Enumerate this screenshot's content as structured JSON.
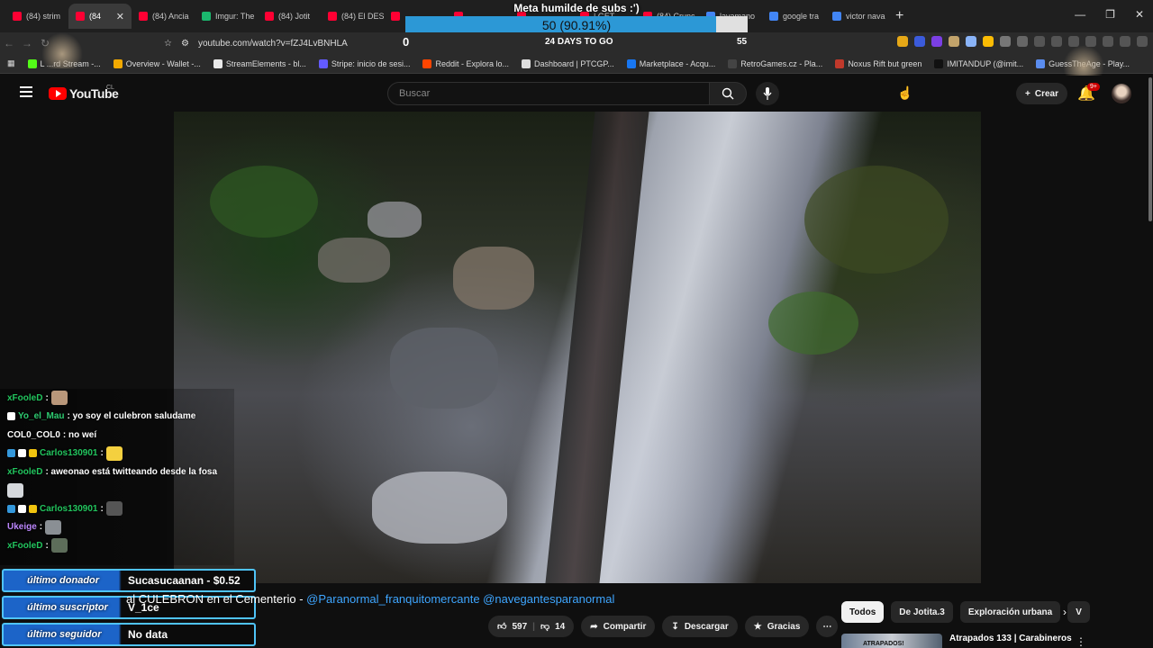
{
  "browser": {
    "tabs": [
      {
        "label": "(84) strim",
        "color": "#ff0033",
        "active": false
      },
      {
        "label": "(84",
        "color": "#ff0033",
        "active": true
      },
      {
        "label": "(84) Ancia",
        "color": "#ff0033",
        "active": false
      },
      {
        "label": "Imgur: The",
        "color": "#1bb76e",
        "active": false
      },
      {
        "label": "(84) Jotit",
        "color": "#ff0033",
        "active": false
      },
      {
        "label": "(84) El DES",
        "color": "#ff0033",
        "active": false
      },
      {
        "label": "",
        "color": "#ff0033",
        "active": false
      },
      {
        "label": "",
        "color": "#ff0033",
        "active": false
      },
      {
        "label": "",
        "color": "#ff0033",
        "active": false
      },
      {
        "label": "| GET",
        "color": "#ff0033",
        "active": false
      },
      {
        "label": "(84) Crunc",
        "color": "#ff0033",
        "active": false
      },
      {
        "label": "lavamano",
        "color": "#4285f4",
        "active": false
      },
      {
        "label": "google tra",
        "color": "#4285f4",
        "active": false
      },
      {
        "label": "victor nava",
        "color": "#4285f4",
        "active": false
      }
    ],
    "url": "youtube.com/watch?v=fZJ4LvBNHLA",
    "bookmarks": [
      {
        "label": "L   ...rd Stream -...",
        "color": "#53fc18"
      },
      {
        "label": "Overview - Wallet -...",
        "color": "#f2a900"
      },
      {
        "label": "StreamElements - bl...",
        "color": "#eaeaea"
      },
      {
        "label": "Stripe: inicio de sesi...",
        "color": "#635bff"
      },
      {
        "label": "Reddit - Explora lo...",
        "color": "#ff4500"
      },
      {
        "label": "Dashboard | PTCGP...",
        "color": "#dddddd"
      },
      {
        "label": "Marketplace - Acqu...",
        "color": "#1877f2"
      },
      {
        "label": "RetroGames.cz - Pla...",
        "color": "#444444"
      },
      {
        "label": "Noxus Rift but green",
        "color": "#c0392b"
      },
      {
        "label": "IMITANDUP (@imit...",
        "color": "#111111"
      },
      {
        "label": "GuessTheAge - Play...",
        "color": "#5b8def"
      }
    ]
  },
  "overlay": {
    "goal_title": "Meta humilde de subs :')",
    "goal_text": "50 (90.91%)",
    "goal_fraction": 0.9091,
    "counter": "0",
    "days": "24 DAYS TO GO",
    "right_counter": "55"
  },
  "youtube": {
    "logo_text": "YouTube",
    "country": "CL",
    "search_placeholder": "Buscar",
    "create_label": "Crear",
    "notifications_badge": "9+"
  },
  "chat": [
    {
      "user": "xFooleD",
      "user_color": "#22c55e",
      "text": ":",
      "emote": "#b9977a",
      "badges": []
    },
    {
      "user": "Yo_el_Mau",
      "user_color": "#2ecc71",
      "text": ": yo soy el culebron saludame",
      "emote": "",
      "badges": [
        "#ffffff"
      ]
    },
    {
      "user": "COL0_COL0",
      "user_color": "#ffffff",
      "text": ": no weí",
      "emote": "",
      "badges": []
    },
    {
      "user": "Carlos130901",
      "user_color": "#22c55e",
      "text": ":",
      "emote": "#f4d03f",
      "badges": [
        "#3498db",
        "#ffffff",
        "#f1c40f"
      ]
    },
    {
      "user": "xFooleD",
      "user_color": "#22c55e",
      "text": ": aweonao está twitteando desde la fosa",
      "emote": "",
      "badges": []
    },
    {
      "user": "",
      "user_color": "#ffffff",
      "text": "",
      "emote": "#d5d8dc",
      "badges": []
    },
    {
      "user": "Carlos130901",
      "user_color": "#22c55e",
      "text": ":",
      "emote": "#555555",
      "badges": [
        "#3498db",
        "#ffffff",
        "#f1c40f"
      ]
    },
    {
      "user": "Ukeige",
      "user_color": "#bb86fc",
      "text": ":",
      "emote": "#8a8f94",
      "badges": []
    },
    {
      "user": "xFooleD",
      "user_color": "#22c55e",
      "text": ":",
      "emote": "#5d6d5a",
      "badges": []
    }
  ],
  "alerts": [
    {
      "label": "último donador",
      "value": "Sucasucaanan - $0.52"
    },
    {
      "label": "último suscriptor",
      "value": "V_1ce"
    },
    {
      "label": "último seguidor",
      "value": "No data"
    }
  ],
  "video": {
    "title_plain": "al CULEBRON en el Cementerio - ",
    "title_links": "@Paranormal_franquitomercante @navegantesparanormal"
  },
  "actions": {
    "likes": "597",
    "dislikes": "14",
    "share": "Compartir",
    "download": "Descargar",
    "thanks": "Gracias"
  },
  "chips": [
    "Todos",
    "De Jotita.3",
    "Exploración urbana",
    "V"
  ],
  "recommendation": {
    "thumb_text": "ATRAPADOS!",
    "title": "Atrapados 133 | Carabineros"
  }
}
